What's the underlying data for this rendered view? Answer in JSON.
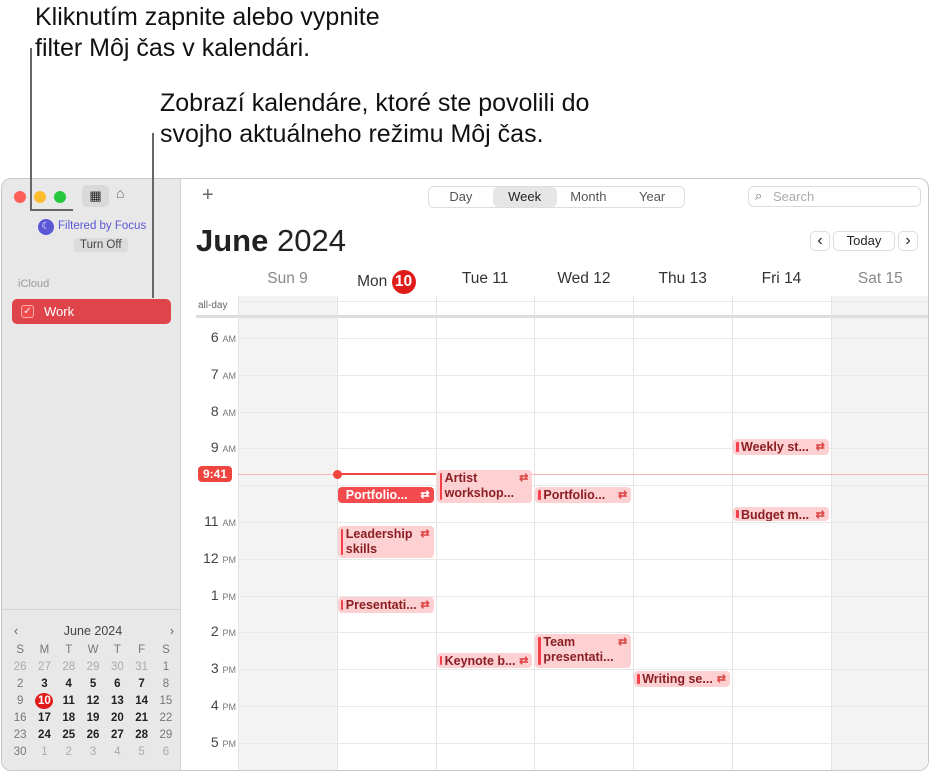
{
  "callouts": [
    "Kliknutím zapnite alebo vypnite",
    "filter Môj čas v kalendári.",
    "Zobrazí kalendáre, ktoré ste povolili do",
    "svojho aktuálneho režimu Môj čas."
  ],
  "sidebar": {
    "focus_label": "Filtered by Focus",
    "turn_off": "Turn Off",
    "group": "iCloud",
    "calendars": [
      {
        "label": "Work",
        "checked": true,
        "color": "#e0444b"
      }
    ]
  },
  "mini": {
    "title": "June 2024",
    "weekdays": [
      "S",
      "M",
      "T",
      "W",
      "T",
      "F",
      "S"
    ],
    "weeks": [
      [
        "26",
        "27",
        "28",
        "29",
        "30",
        "31",
        "1"
      ],
      [
        "2",
        "3",
        "4",
        "5",
        "6",
        "7",
        "8"
      ],
      [
        "9",
        "10",
        "11",
        "12",
        "13",
        "14",
        "15"
      ],
      [
        "16",
        "17",
        "18",
        "19",
        "20",
        "21",
        "22"
      ],
      [
        "23",
        "24",
        "25",
        "26",
        "27",
        "28",
        "29"
      ],
      [
        "30",
        "1",
        "2",
        "3",
        "4",
        "5",
        "6"
      ]
    ],
    "today": "10"
  },
  "toolbar": {
    "add": "+",
    "views": [
      "Day",
      "Week",
      "Month",
      "Year"
    ],
    "selected_view": "Week",
    "search_placeholder": "Search",
    "today": "Today"
  },
  "header": {
    "month": "June",
    "year": "2024"
  },
  "days": [
    {
      "name": "Sun",
      "num": "9"
    },
    {
      "name": "Mon",
      "num": "10",
      "today": true
    },
    {
      "name": "Tue",
      "num": "11"
    },
    {
      "name": "Wed",
      "num": "12"
    },
    {
      "name": "Thu",
      "num": "13"
    },
    {
      "name": "Fri",
      "num": "14"
    },
    {
      "name": "Sat",
      "num": "15"
    }
  ],
  "allday": "all-day",
  "hours": [
    {
      "h": "6",
      "ap": "AM"
    },
    {
      "h": "7",
      "ap": "AM"
    },
    {
      "h": "8",
      "ap": "AM"
    },
    {
      "h": "9",
      "ap": "AM"
    },
    {
      "h": "",
      "ap": ""
    },
    {
      "h": "11",
      "ap": "AM"
    },
    {
      "h": "12",
      "ap": "PM"
    },
    {
      "h": "1",
      "ap": "PM"
    },
    {
      "h": "2",
      "ap": "PM"
    },
    {
      "h": "3",
      "ap": "PM"
    },
    {
      "h": "4",
      "ap": "PM"
    },
    {
      "h": "5",
      "ap": "PM"
    }
  ],
  "now": "9:41",
  "accent": "#f0443f",
  "events": [
    {
      "title": "Weekly st...",
      "day": 5,
      "start": 8.75,
      "end": 9.2
    },
    {
      "title": "Artist workshop...",
      "day": 2,
      "start": 9.6,
      "end": 10.5
    },
    {
      "title": "Portfolio...",
      "day": 1,
      "start": 10.05,
      "end": 10.5,
      "selected": true
    },
    {
      "title": "Portfolio...",
      "day": 3,
      "start": 10.05,
      "end": 10.5
    },
    {
      "title": "Budget m...",
      "day": 5,
      "start": 10.6,
      "end": 11.0
    },
    {
      "title": "Leadership skills work...",
      "day": 1,
      "start": 11.1,
      "end": 12.0
    },
    {
      "title": "Presentati...",
      "day": 1,
      "start": 13.05,
      "end": 13.5
    },
    {
      "title": "Keynote b...",
      "day": 2,
      "start": 14.55,
      "end": 15.0
    },
    {
      "title": "Team presentati...",
      "day": 3,
      "start": 14.05,
      "end": 15.0
    },
    {
      "title": "Writing se...",
      "day": 4,
      "start": 15.05,
      "end": 15.5
    }
  ]
}
